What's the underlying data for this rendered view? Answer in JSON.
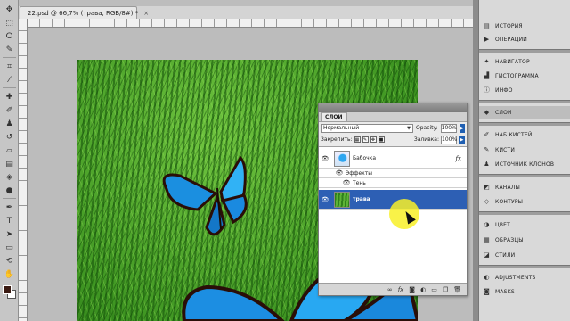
{
  "document": {
    "tab_title": "22.psd @ 66,7% (трава, RGB/8#) *",
    "close_glyph": "×"
  },
  "toolbar": {
    "tools": [
      "move-tool",
      "marquee-tool",
      "lasso-tool",
      "quick-select-tool",
      "crop-tool",
      "eyedropper-tool",
      "healing-brush-tool",
      "brush-tool",
      "clone-stamp-tool",
      "history-brush-tool",
      "eraser-tool",
      "gradient-tool",
      "blur-tool",
      "dodge-tool",
      "pen-tool",
      "type-tool",
      "path-select-tool",
      "shape-tool",
      "3d-rotate-tool",
      "3d-orbit-tool",
      "hand-tool",
      "zoom-tool"
    ],
    "colors": {
      "foreground": "#3a1a12",
      "background": "#ffffff"
    }
  },
  "layers_panel": {
    "tab_label": "СЛОИ",
    "blend_mode": "Нормальный",
    "opacity_label": "Opacity:",
    "opacity_value": "100%",
    "lock_label": "Закрепить:",
    "fill_label": "Заливка:",
    "fill_value": "100%",
    "layers": [
      {
        "name": "Бабочка",
        "fx": "fx",
        "selected": false
      },
      {
        "name": "Эффекты",
        "sub": true
      },
      {
        "name": "Тень",
        "sub": true
      },
      {
        "name": "трава",
        "selected": true
      }
    ],
    "footer_icons": [
      "link-icon",
      "fx-icon",
      "mask-icon",
      "adjustment-icon",
      "group-icon",
      "new-layer-icon",
      "trash-icon"
    ]
  },
  "dock": {
    "items": [
      {
        "label": "ИСТОРИЯ",
        "icon": "history-icon"
      },
      {
        "label": "ОПЕРАЦИИ",
        "icon": "actions-icon"
      },
      {
        "label": "НАВИГАТОР",
        "icon": "navigator-icon"
      },
      {
        "label": "ГИСТОГРАММА",
        "icon": "histogram-icon"
      },
      {
        "label": "ИНФО",
        "icon": "info-icon"
      },
      {
        "label": "СЛОИ",
        "icon": "layers-icon",
        "active": true
      },
      {
        "label": "НАБ.КИСТЕЙ",
        "icon": "brush-presets-icon"
      },
      {
        "label": "КИСТИ",
        "icon": "brushes-icon"
      },
      {
        "label": "ИСТОЧНИК КЛОНОВ",
        "icon": "clone-source-icon"
      },
      {
        "label": "КАНАЛЫ",
        "icon": "channels-icon"
      },
      {
        "label": "КОНТУРЫ",
        "icon": "paths-icon"
      },
      {
        "label": "ЦВЕТ",
        "icon": "color-icon"
      },
      {
        "label": "ОБРАЗЦЫ",
        "icon": "swatches-icon"
      },
      {
        "label": "СТИЛИ",
        "icon": "styles-icon"
      },
      {
        "label": "ADJUSTMENTS",
        "icon": "adjustments-icon"
      },
      {
        "label": "MASKS",
        "icon": "masks-icon"
      }
    ]
  },
  "colors": {
    "selection": "#2d5fb4",
    "grass": "#3f9622",
    "butterfly": "#2ea6f0",
    "cursor_highlight": "#f8f028"
  }
}
